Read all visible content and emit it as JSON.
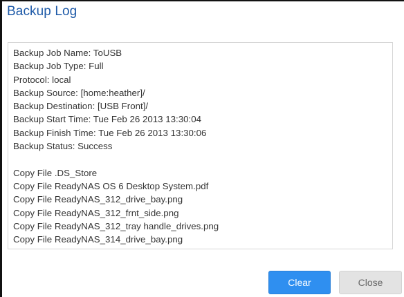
{
  "dialog": {
    "title": "Backup Log",
    "log_summary": [
      "Backup Job Name: ToUSB",
      "Backup Job Type: Full",
      "Protocol: local",
      "Backup Source: [home:heather]/",
      "Backup Destination: [USB Front]/",
      "Backup Start Time: Tue Feb 26 2013 13:30:04",
      "Backup Finish Time: Tue Feb 26 2013 13:30:06",
      "Backup Status: Success"
    ],
    "log_files": [
      "Copy File .DS_Store",
      "Copy File ReadyNAS OS 6 Desktop System.pdf",
      "Copy File ReadyNAS_312_drive_bay.png",
      "Copy File ReadyNAS_312_frnt_side.png",
      "Copy File ReadyNAS_312_tray handle_drives.png",
      "Copy File ReadyNAS_314_drive_bay.png"
    ],
    "buttons": {
      "clear_label": "Clear",
      "close_label": "Close"
    },
    "colors": {
      "title": "#1e5aa8",
      "primary_button": "#2f8ff0",
      "secondary_button": "#e3e3e3"
    }
  }
}
